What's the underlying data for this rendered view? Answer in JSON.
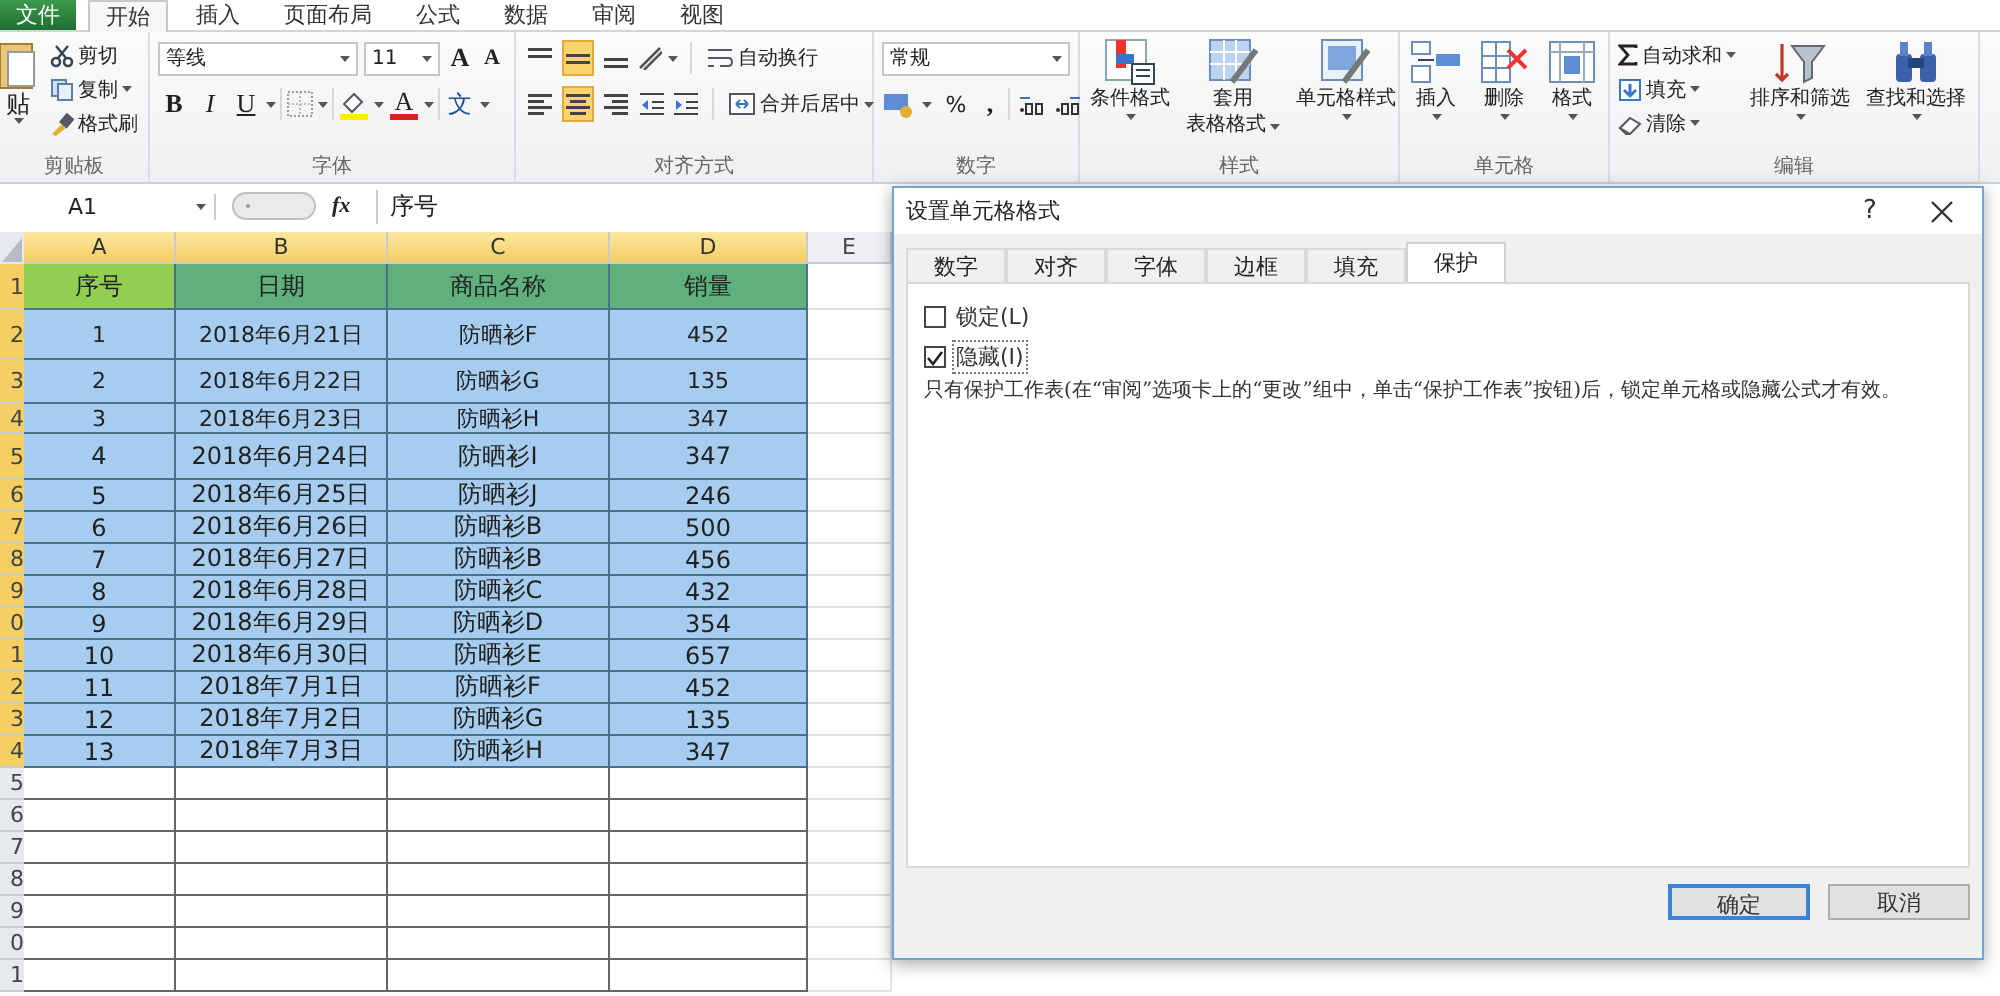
{
  "menu_tabs": [
    {
      "label": "文件",
      "kind": "file",
      "selected": false
    },
    {
      "label": "开始",
      "kind": "tab",
      "selected": true
    },
    {
      "label": "插入",
      "kind": "tab",
      "selected": false
    },
    {
      "label": "页面布局",
      "kind": "tab",
      "selected": false
    },
    {
      "label": "公式",
      "kind": "tab",
      "selected": false
    },
    {
      "label": "数据",
      "kind": "tab",
      "selected": false
    },
    {
      "label": "审阅",
      "kind": "tab",
      "selected": false
    },
    {
      "label": "视图",
      "kind": "tab",
      "selected": false
    }
  ],
  "ribbon": {
    "clipboard": {
      "label": "剪贴板",
      "paste": "贴",
      "items": [
        "剪切",
        "复制",
        "格式刷"
      ]
    },
    "font": {
      "label": "字体",
      "font_name": "等线",
      "font_size": "11",
      "grow": "A",
      "shrink": "A",
      "bold": "B",
      "italic": "I",
      "underline": "U",
      "font_color": "A",
      "phonetic": "文"
    },
    "alignment": {
      "label": "对齐方式",
      "vertical_align": [
        {
          "selected": false
        },
        {
          "selected": true
        },
        {
          "selected": false
        }
      ],
      "horizontal_align": [
        {
          "selected": false
        },
        {
          "selected": true
        },
        {
          "selected": false
        }
      ],
      "wrap": "自动换行",
      "merge": "合并后居中"
    },
    "number": {
      "label": "数字",
      "format": "常规",
      "percent": "%",
      "comma": ","
    },
    "styles": {
      "label": "样式",
      "buttons": [
        [
          "条件格式"
        ],
        [
          "套用",
          "表格格式"
        ],
        [
          "单元格样式"
        ]
      ]
    },
    "cells": {
      "label": "单元格",
      "buttons": [
        "插入",
        "删除",
        "格式"
      ]
    },
    "editing": {
      "label": "编辑",
      "small": [
        "自动求和",
        "填充",
        "清除"
      ],
      "big": [
        "排序和筛选",
        "查找和选择"
      ]
    }
  },
  "formula_bar": {
    "name_box": "A1",
    "fx": "fx",
    "formula": "序号"
  },
  "sheet": {
    "columns": [
      {
        "label": "A",
        "selected": true
      },
      {
        "label": "B",
        "selected": true
      },
      {
        "label": "C",
        "selected": true
      },
      {
        "label": "D",
        "selected": true
      },
      {
        "label": "E",
        "selected": false
      }
    ],
    "row_headers": [
      {
        "label": "1",
        "selected": true
      },
      {
        "label": "2",
        "selected": true
      },
      {
        "label": "3",
        "selected": true
      },
      {
        "label": "4",
        "selected": true
      },
      {
        "label": "5",
        "selected": true
      },
      {
        "label": "6",
        "selected": true
      },
      {
        "label": "7",
        "selected": true
      },
      {
        "label": "8",
        "selected": true
      },
      {
        "label": "9",
        "selected": true
      },
      {
        "label": "0",
        "selected": true
      },
      {
        "label": "1",
        "selected": true
      },
      {
        "label": "2",
        "selected": true
      },
      {
        "label": "3",
        "selected": true
      },
      {
        "label": "4",
        "selected": true
      },
      {
        "label": "5",
        "selected": false
      },
      {
        "label": "6",
        "selected": false
      },
      {
        "label": "7",
        "selected": false
      },
      {
        "label": "8",
        "selected": false
      },
      {
        "label": "9",
        "selected": false
      },
      {
        "label": "0",
        "selected": false
      },
      {
        "label": "1",
        "selected": false
      }
    ],
    "header": [
      "序号",
      "日期",
      "商品名称",
      "销量"
    ],
    "rows": [
      [
        "1",
        "2018年6月21日",
        "防晒衫F",
        "452"
      ],
      [
        "2",
        "2018年6月22日",
        "防晒衫G",
        "135"
      ],
      [
        "3",
        "2018年6月23日",
        "防晒衫H",
        "347"
      ],
      [
        "4",
        "2018年6月24日",
        "防晒衫I",
        "347"
      ],
      [
        "5",
        "2018年6月25日",
        "防晒衫J",
        "246"
      ],
      [
        "6",
        "2018年6月26日",
        "防晒衫B",
        "500"
      ],
      [
        "7",
        "2018年6月27日",
        "防晒衫B",
        "456"
      ],
      [
        "8",
        "2018年6月28日",
        "防晒衫C",
        "432"
      ],
      [
        "9",
        "2018年6月29日",
        "防晒衫D",
        "354"
      ],
      [
        "10",
        "2018年6月30日",
        "防晒衫E",
        "657"
      ],
      [
        "11",
        "2018年7月1日",
        "防晒衫F",
        "452"
      ],
      [
        "12",
        "2018年7月2日",
        "防晒衫G",
        "135"
      ],
      [
        "13",
        "2018年7月3日",
        "防晒衫H",
        "347"
      ]
    ]
  },
  "dialog": {
    "title": "设置单元格格式",
    "help": "?",
    "tabs": [
      {
        "label": "数字",
        "selected": false
      },
      {
        "label": "对齐",
        "selected": false
      },
      {
        "label": "字体",
        "selected": false
      },
      {
        "label": "边框",
        "selected": false
      },
      {
        "label": "填充",
        "selected": false
      },
      {
        "label": "保护",
        "selected": true
      }
    ],
    "options": [
      {
        "label": "锁定(L)",
        "checked": false,
        "focused": false
      },
      {
        "label": "隐藏(I)",
        "checked": true,
        "focused": true
      }
    ],
    "note": "只有保护工作表(在“审阅”选项卡上的“更改”组中，单击“保护工作表”按钮)后，锁定单元格或隐藏公式才有效。",
    "buttons": [
      {
        "label": "确定",
        "focused": true
      },
      {
        "label": "取消",
        "focused": false
      }
    ]
  }
}
